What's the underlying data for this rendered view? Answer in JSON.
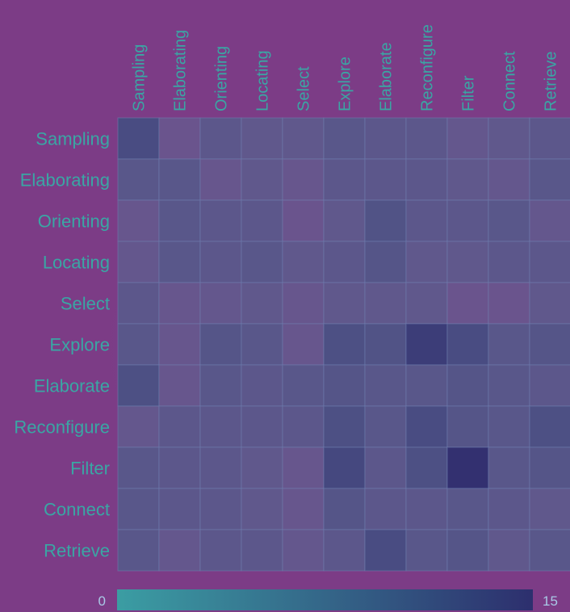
{
  "chart_data": {
    "type": "heatmap",
    "rows": [
      "Sampling",
      "Elaborating",
      "Orienting",
      "Locating",
      "Select",
      "Explore",
      "Elaborate",
      "Reconfigure",
      "Filter",
      "Connect",
      "Retrieve"
    ],
    "columns": [
      "Sampling",
      "Elaborating",
      "Orienting",
      "Locating",
      "Select",
      "Explore",
      "Elaborate",
      "Reconfigure",
      "Filter",
      "Connect",
      "Retrieve"
    ],
    "values": [
      [
        10,
        1,
        5,
        4,
        4,
        6,
        5,
        5,
        3,
        4,
        5
      ],
      [
        6,
        6,
        2,
        4,
        2,
        5,
        5,
        5,
        4,
        3,
        6
      ],
      [
        2,
        6,
        5,
        5,
        1,
        4,
        8,
        5,
        5,
        6,
        3
      ],
      [
        3,
        6,
        5,
        6,
        4,
        5,
        7,
        4,
        4,
        5,
        5
      ],
      [
        5,
        2,
        3,
        4,
        2,
        4,
        4,
        4,
        1,
        1,
        4
      ],
      [
        6,
        2,
        7,
        6,
        2,
        9,
        8,
        13,
        10,
        6,
        7
      ],
      [
        9,
        2,
        6,
        5,
        6,
        7,
        6,
        6,
        7,
        6,
        5
      ],
      [
        3,
        5,
        5,
        5,
        5,
        9,
        6,
        10,
        7,
        6,
        9
      ],
      [
        6,
        5,
        5,
        4,
        2,
        11,
        5,
        9,
        15,
        6,
        7
      ],
      [
        6,
        5,
        5,
        4,
        2,
        7,
        5,
        5,
        6,
        5,
        4
      ],
      [
        6,
        3,
        5,
        5,
        3,
        5,
        10,
        6,
        7,
        4,
        6
      ]
    ],
    "colorbar": {
      "min": 0,
      "max": 15,
      "min_label": "0",
      "max_label": "15"
    },
    "colors": {
      "low": "#3b9da3",
      "high": "#2d2f6e",
      "background": "#7c3c86",
      "label": "#3aa6a4"
    }
  }
}
